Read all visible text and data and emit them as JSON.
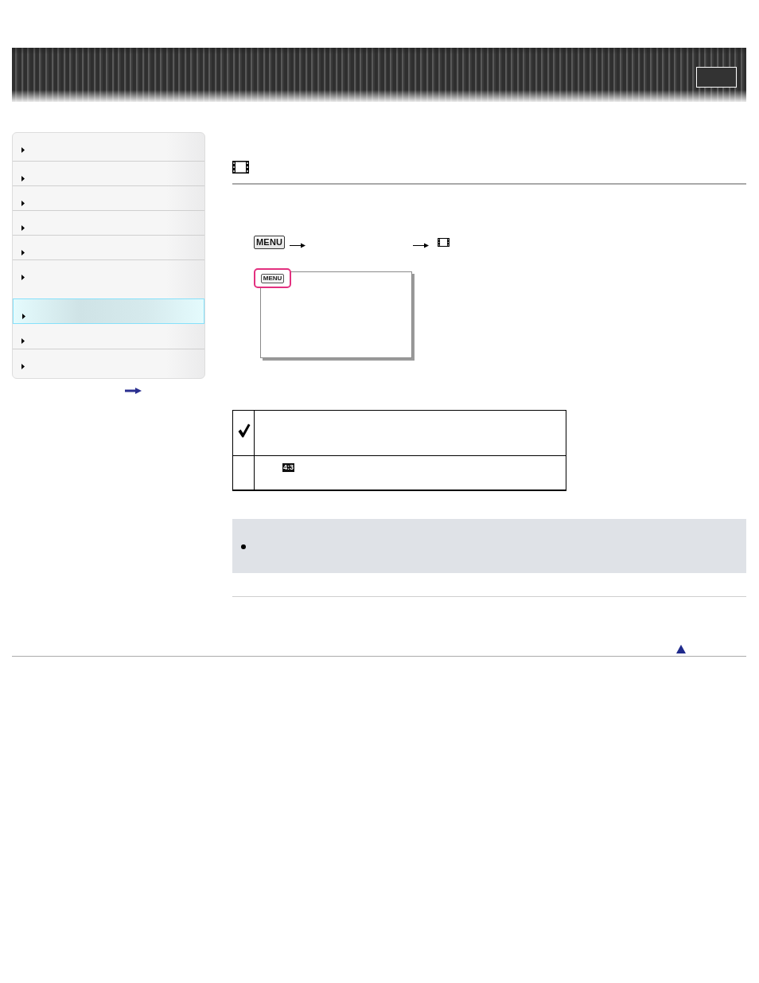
{
  "sidebar": {
    "items": [
      {
        "selected": false
      },
      {
        "selected": false
      },
      {
        "selected": false
      },
      {
        "selected": false
      },
      {
        "selected": false
      },
      {
        "selected": false
      },
      {
        "selected": true
      },
      {
        "selected": false
      },
      {
        "selected": false
      }
    ]
  },
  "procedure": {
    "menu_key": "MENU",
    "screen": {
      "menu_key": "MENU"
    }
  },
  "table": {
    "rows": [
      {
        "checked": true
      },
      {
        "checked": false,
        "badge": "4:3"
      }
    ]
  }
}
